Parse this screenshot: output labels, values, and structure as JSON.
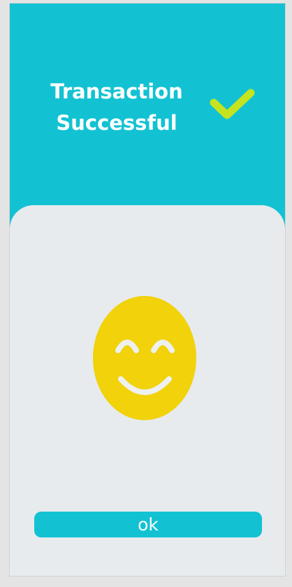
{
  "header": {
    "title_line1": "Transaction",
    "title_line2": "Successful",
    "status_icon": "checkmark-icon"
  },
  "main": {
    "illustration_icon": "smiley-face-icon",
    "ok_label": "ok"
  },
  "colors": {
    "header_bg": "#12c2d3",
    "card_bg": "#e7ebee",
    "checkmark": "#c6e31f",
    "smiley": "#f1d20b",
    "button_bg": "#12c2d3",
    "button_text": "#ffffff"
  }
}
